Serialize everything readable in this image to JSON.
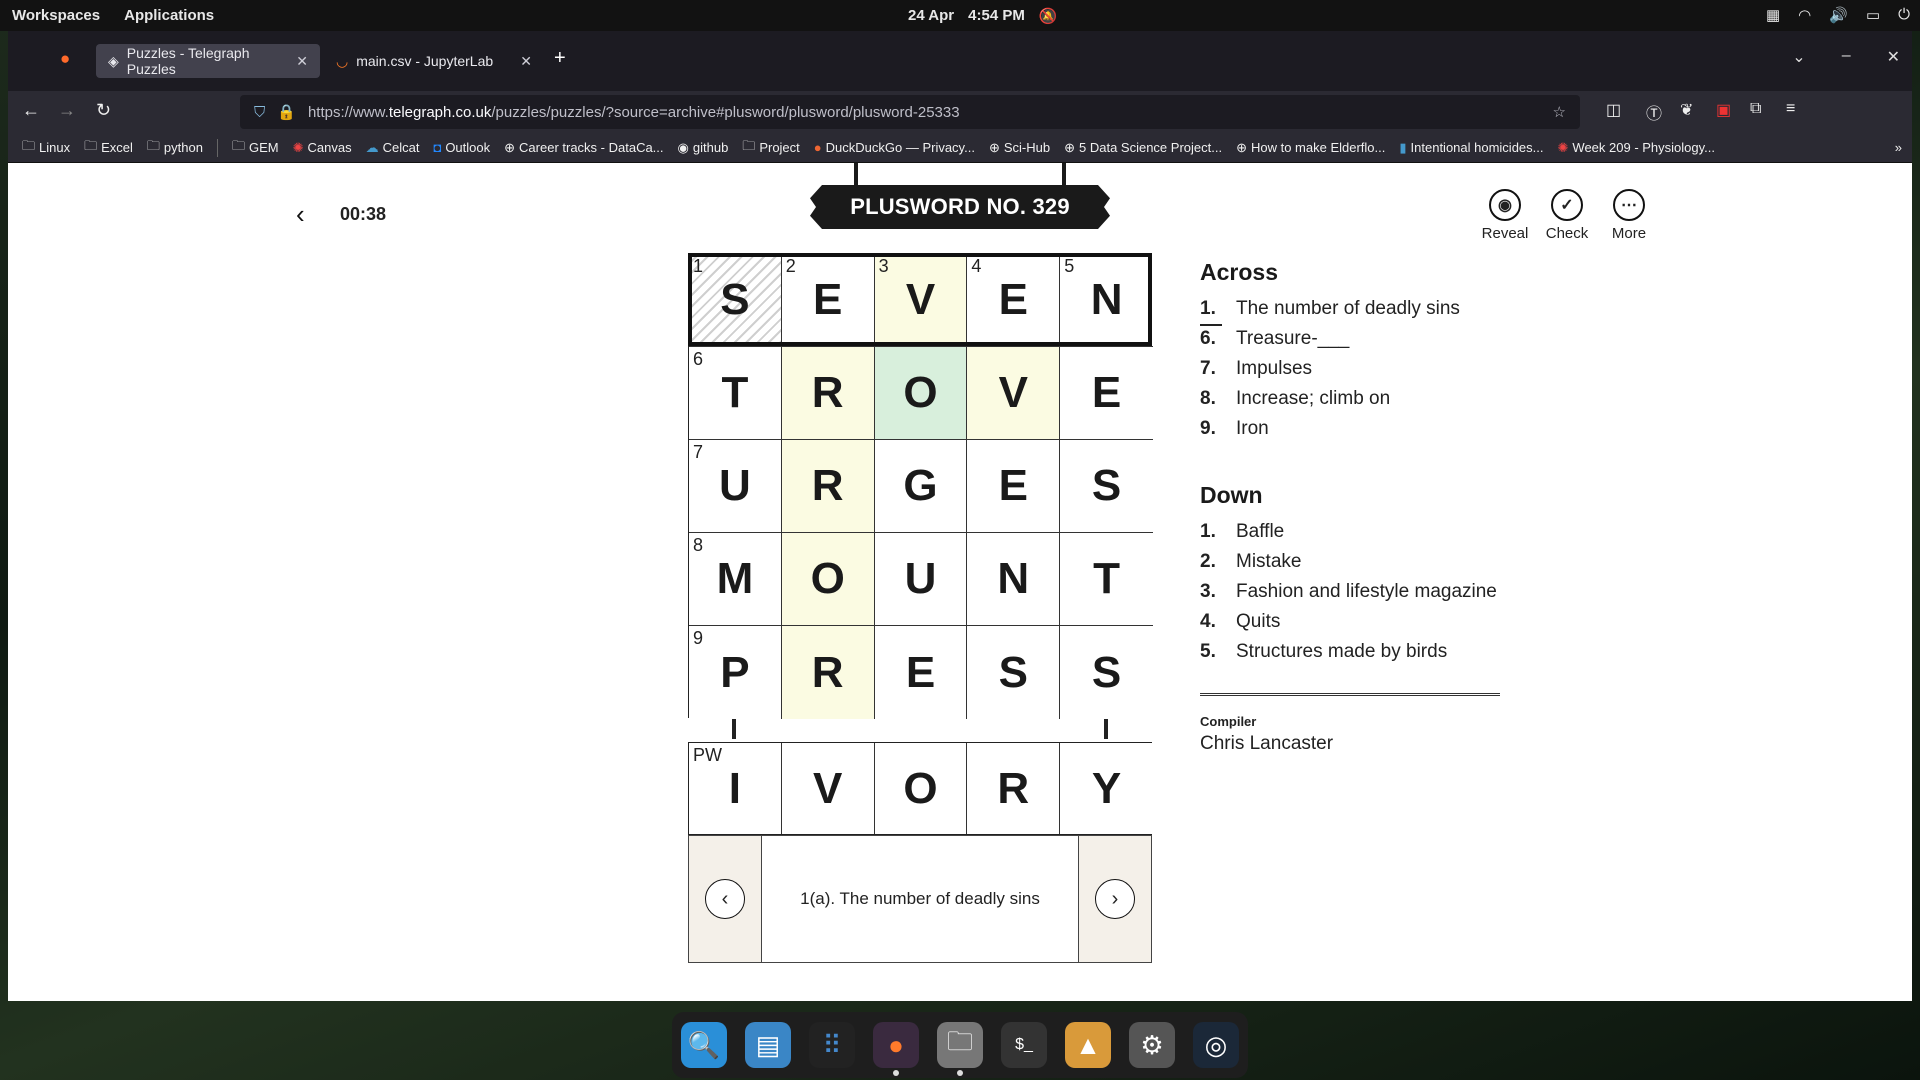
{
  "topbar": {
    "workspaces": "Workspaces",
    "applications": "Applications",
    "date": "24 Apr",
    "time": "4:54 PM"
  },
  "browser": {
    "tabs": [
      {
        "label": "Puzzles - Telegraph Puzzles",
        "active": true
      },
      {
        "label": "main.csv - JupyterLab",
        "active": false
      }
    ],
    "url_prefix": "https://www.",
    "url_host": "telegraph.co.uk",
    "url_path": "/puzzles/puzzles/?source=archive#plusword/plusword/plusword-25333",
    "bookmarks": [
      "Linux",
      "Excel",
      "python",
      "GEM",
      "Canvas",
      "Celcat",
      "Outlook",
      "Career tracks - DataCa...",
      "github",
      "Project",
      "DuckDuckGo — Privacy...",
      "Sci-Hub",
      "5 Data Science Project...",
      "How to make Elderflo...",
      "Intentional homicides...",
      "Week 209 - Physiology..."
    ]
  },
  "puzzle": {
    "timer": "00:38",
    "title": "PLUSWORD NO. 329",
    "tools": {
      "reveal": "Reveal",
      "check": "Check",
      "more": "More"
    },
    "grid": [
      [
        "S",
        "E",
        "V",
        "E",
        "N"
      ],
      [
        "T",
        "R",
        "O",
        "V",
        "E"
      ],
      [
        "U",
        "R",
        "G",
        "E",
        "S"
      ],
      [
        "M",
        "O",
        "U",
        "N",
        "T"
      ],
      [
        "P",
        "R",
        "E",
        "S",
        "S"
      ]
    ],
    "numbers": {
      "r0c0": "1",
      "r0c1": "2",
      "r0c2": "3",
      "r0c3": "4",
      "r0c4": "5",
      "r1c0": "6",
      "r2c0": "7",
      "r3c0": "8",
      "r4c0": "9"
    },
    "plusword_label": "PW",
    "plusword": [
      "I",
      "V",
      "O",
      "R",
      "Y"
    ],
    "current_clue": "1(a). The number of deadly sins",
    "across_title": "Across",
    "across": [
      {
        "n": "1.",
        "text": "The number of deadly sins"
      },
      {
        "n": "6.",
        "text": "Treasure-___"
      },
      {
        "n": "7.",
        "text": "Impulses"
      },
      {
        "n": "8.",
        "text": "Increase; climb on"
      },
      {
        "n": "9.",
        "text": "Iron"
      }
    ],
    "down_title": "Down",
    "down": [
      {
        "n": "1.",
        "text": "Baffle"
      },
      {
        "n": "2.",
        "text": "Mistake"
      },
      {
        "n": "3.",
        "text": "Fashion and lifestyle magazine"
      },
      {
        "n": "4.",
        "text": "Quits"
      },
      {
        "n": "5.",
        "text": "Structures made by birds"
      }
    ],
    "compiler_label": "Compiler",
    "compiler_name": "Chris Lancaster"
  },
  "colors": {
    "highlight": "#fbfbe2",
    "crossing": "#d8efdc",
    "plate": "#1a1a1a"
  }
}
